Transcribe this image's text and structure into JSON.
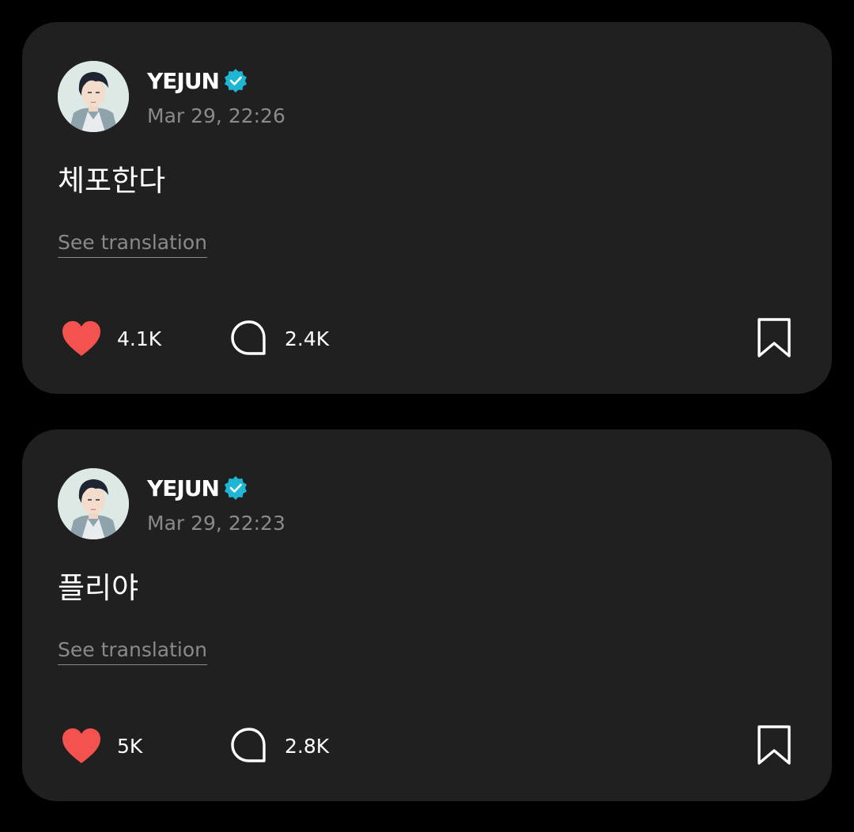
{
  "posts": [
    {
      "author": "YEJUN",
      "timestamp": "Mar 29, 22:26",
      "text": "체포한다",
      "translate_label": "See translation",
      "likes": "4.1K",
      "comments": "2.4K"
    },
    {
      "author": "YEJUN",
      "timestamp": "Mar 29, 22:23",
      "text": "플리야",
      "translate_label": "See translation",
      "likes": "5K",
      "comments": "2.8K"
    }
  ],
  "colors": {
    "background": "#000000",
    "card": "#202020",
    "like": "#f4524f",
    "verified": "#1fb6d3",
    "muted_text": "#8a8a8a"
  },
  "icons": {
    "verified": "verified-badge-icon",
    "like": "heart-icon",
    "comment": "comment-bubble-icon",
    "save": "bookmark-icon"
  }
}
